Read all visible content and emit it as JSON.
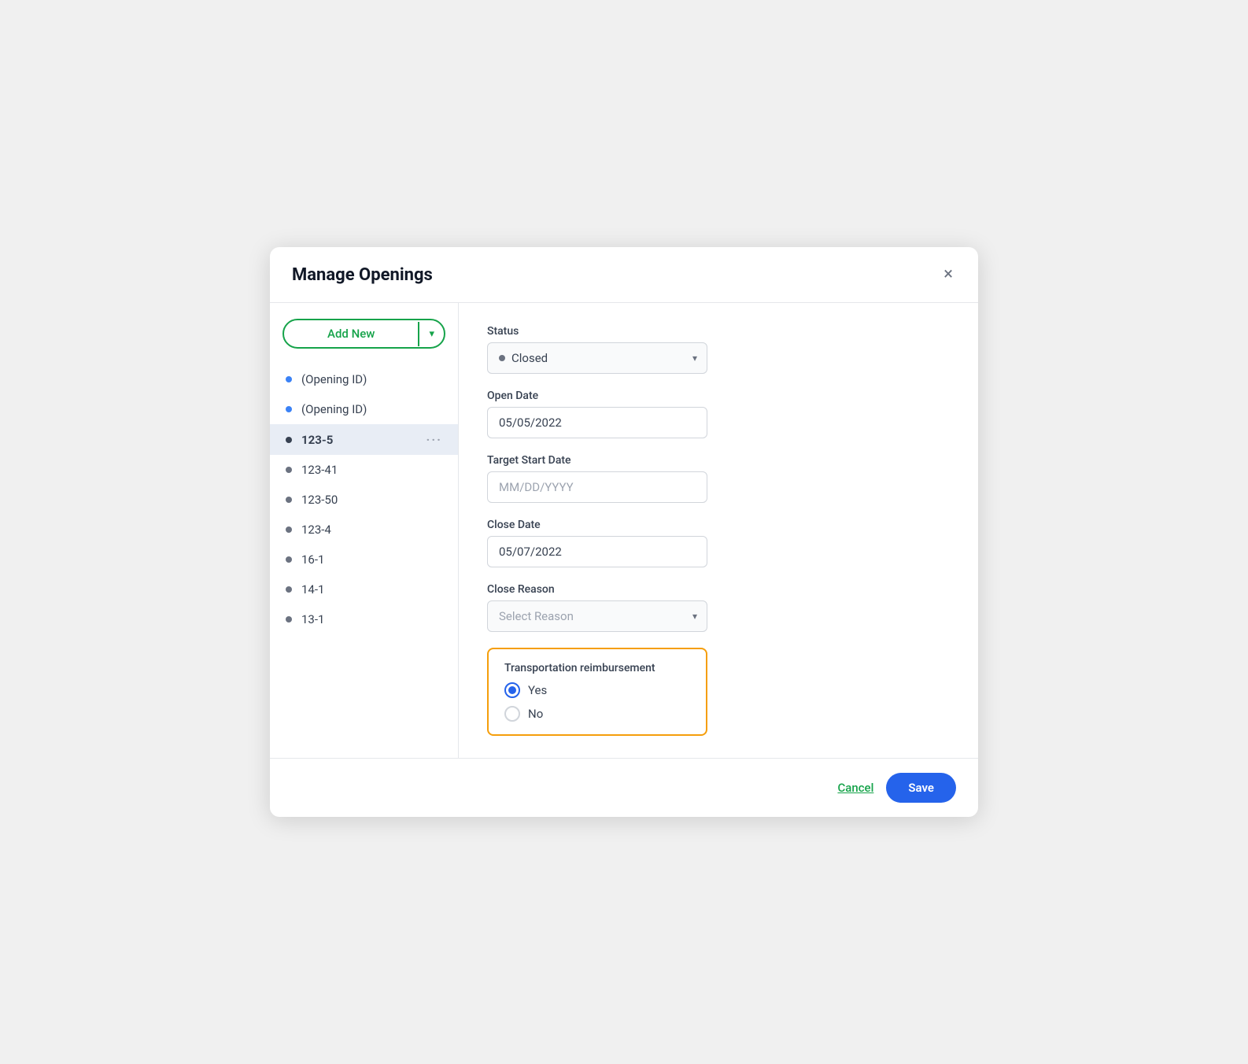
{
  "modal": {
    "title": "Manage Openings",
    "close_label": "×"
  },
  "sidebar": {
    "add_new_label": "Add New",
    "add_new_arrow": "▾",
    "items": [
      {
        "id": "opening-id-1",
        "label": "(Opening ID)",
        "dot_color": "blue",
        "active": false
      },
      {
        "id": "opening-id-2",
        "label": "(Opening ID)",
        "dot_color": "blue",
        "active": false
      },
      {
        "id": "123-5",
        "label": "123-5",
        "dot_color": "gray",
        "active": true
      },
      {
        "id": "123-41",
        "label": "123-41",
        "dot_color": "gray",
        "active": false
      },
      {
        "id": "123-50",
        "label": "123-50",
        "dot_color": "gray",
        "active": false
      },
      {
        "id": "123-4",
        "label": "123-4",
        "dot_color": "gray",
        "active": false
      },
      {
        "id": "16-1",
        "label": "16-1",
        "dot_color": "gray",
        "active": false
      },
      {
        "id": "14-1",
        "label": "14-1",
        "dot_color": "gray",
        "active": false
      },
      {
        "id": "13-1",
        "label": "13-1",
        "dot_color": "gray",
        "active": false
      }
    ]
  },
  "form": {
    "status_label": "Status",
    "status_value": "Closed",
    "status_dot_color": "#6b7280",
    "open_date_label": "Open Date",
    "open_date_value": "05/05/2022",
    "target_start_date_label": "Target Start Date",
    "target_start_date_placeholder": "MM/DD/YYYY",
    "close_date_label": "Close Date",
    "close_date_value": "05/07/2022",
    "close_reason_label": "Close Reason",
    "close_reason_placeholder": "Select Reason",
    "transport_title": "Transportation reimbursement",
    "transport_yes": "Yes",
    "transport_no": "No",
    "transport_yes_checked": true,
    "transport_no_checked": false
  },
  "footer": {
    "cancel_label": "Cancel",
    "save_label": "Save"
  }
}
